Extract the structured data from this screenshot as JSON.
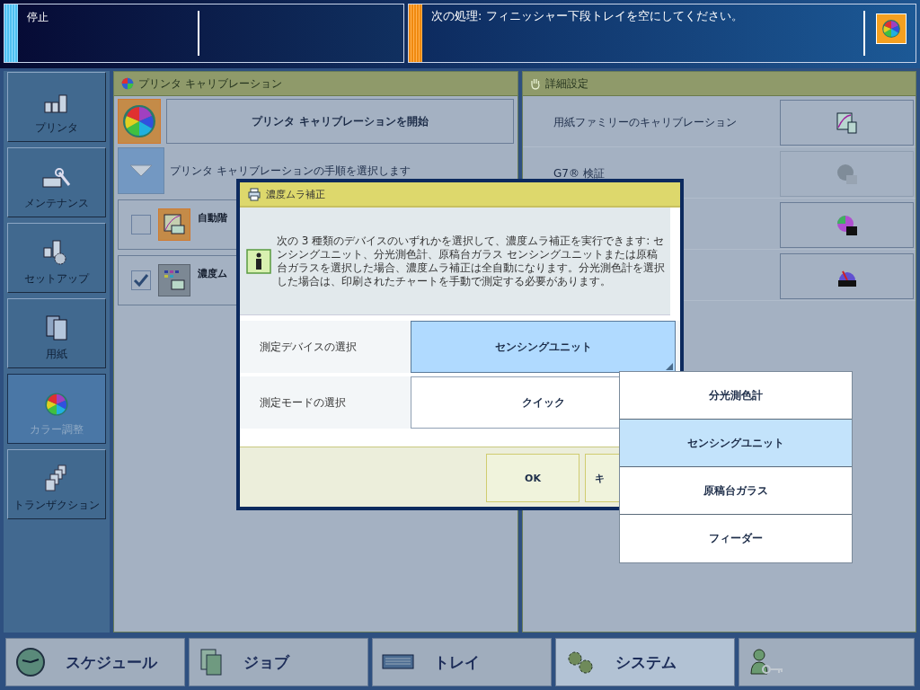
{
  "status_bar": {
    "state": "停止",
    "next_action": "次の処理: フィニッシャー下段トレイを空にしてください。"
  },
  "sidebar": {
    "items": [
      {
        "label": "プリンタ",
        "selected": false
      },
      {
        "label": "メンテナンス",
        "selected": false
      },
      {
        "label": "セットアップ",
        "selected": false
      },
      {
        "label": "用紙",
        "selected": false
      },
      {
        "label": "カラー調整",
        "selected": true
      },
      {
        "label": "トランザクション",
        "selected": false
      }
    ]
  },
  "calibration_panel": {
    "title": "プリンタ キャリブレーション",
    "start_button": "プリンタ キャリブレーションを開始",
    "procedure_label": "プリンタ キャリブレーションの手順を選択します",
    "steps": [
      {
        "label": "自動階",
        "checked": false
      },
      {
        "label": "濃度ム",
        "checked": true
      }
    ]
  },
  "advanced_panel": {
    "title": "詳細設定",
    "rows": [
      {
        "label": "用紙ファミリーのキャリブレーション",
        "disabled": false
      },
      {
        "label": "G7® 検証",
        "disabled": true
      },
      {
        "disabled": false
      },
      {
        "disabled": false
      }
    ]
  },
  "dialog": {
    "title": "濃度ムラ補正",
    "message": "次の 3 種類のデバイスのいずれかを選択して、濃度ムラ補正を実行できます: センシングユニット、分光測色計、原稿台ガラス センシングユニットまたは原稿台ガラスを選択した場合、濃度ムラ補正は全自動になります。分光測色計を選択した場合は、印刷されたチャートを手動で測定する必要があります。",
    "fields": [
      {
        "label": "測定デバイスの選択",
        "value": "センシングユニット",
        "expanded": true
      },
      {
        "label": "測定モードの選択",
        "value": "クイック",
        "expanded": false
      }
    ],
    "buttons": [
      "OK",
      "キ"
    ]
  },
  "dropdown": {
    "options": [
      {
        "label": "分光測色計",
        "selected": false
      },
      {
        "label": "センシングユニット",
        "selected": true
      },
      {
        "label": "原稿台ガラス",
        "selected": false
      },
      {
        "label": "フィーダー",
        "selected": false
      }
    ]
  },
  "bottom_tabs": [
    {
      "label": "スケジュール",
      "selected": false
    },
    {
      "label": "ジョブ",
      "selected": false
    },
    {
      "label": "トレイ",
      "selected": false
    },
    {
      "label": "システム",
      "selected": true
    }
  ]
}
